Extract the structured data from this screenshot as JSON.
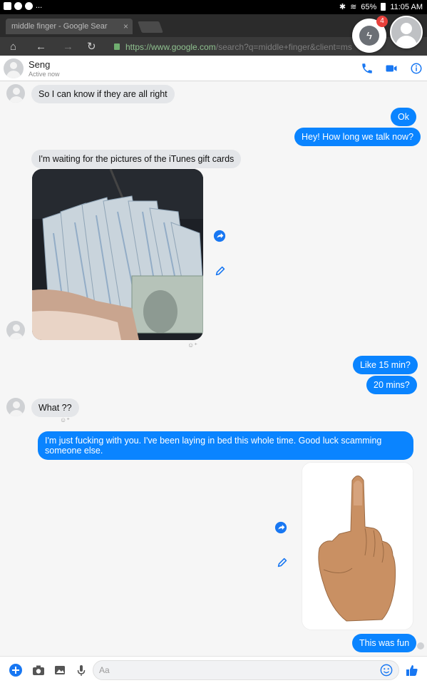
{
  "status_bar": {
    "overflow": "...",
    "battery": "65%",
    "time": "11:05 AM"
  },
  "browser": {
    "tab_title": "middle finger - Google Sear",
    "url_main": "https://www.google.com",
    "url_rest": "/search?q=middle+finger&client=ms"
  },
  "chat_heads": {
    "unread_badge": "4"
  },
  "header": {
    "contact_name": "Seng",
    "status": "Active now"
  },
  "messages": {
    "m1": "So I can know if they are all right",
    "m2": "Ok",
    "m3": "Hey! How long we talk now?",
    "m4": "I'm waiting for the pictures of the iTunes gift cards",
    "m5": "Like 15 min?",
    "m6": "20 mins?",
    "m7": "What ??",
    "m8": "I'm just fucking with you. I've been laying in bed this whole time. Good luck scamming someone else.",
    "m9": "This was fun"
  },
  "composer": {
    "placeholder": "Aa"
  },
  "colors": {
    "accent": "#0a84ff",
    "incoming_bubble": "#e4e6e9"
  }
}
